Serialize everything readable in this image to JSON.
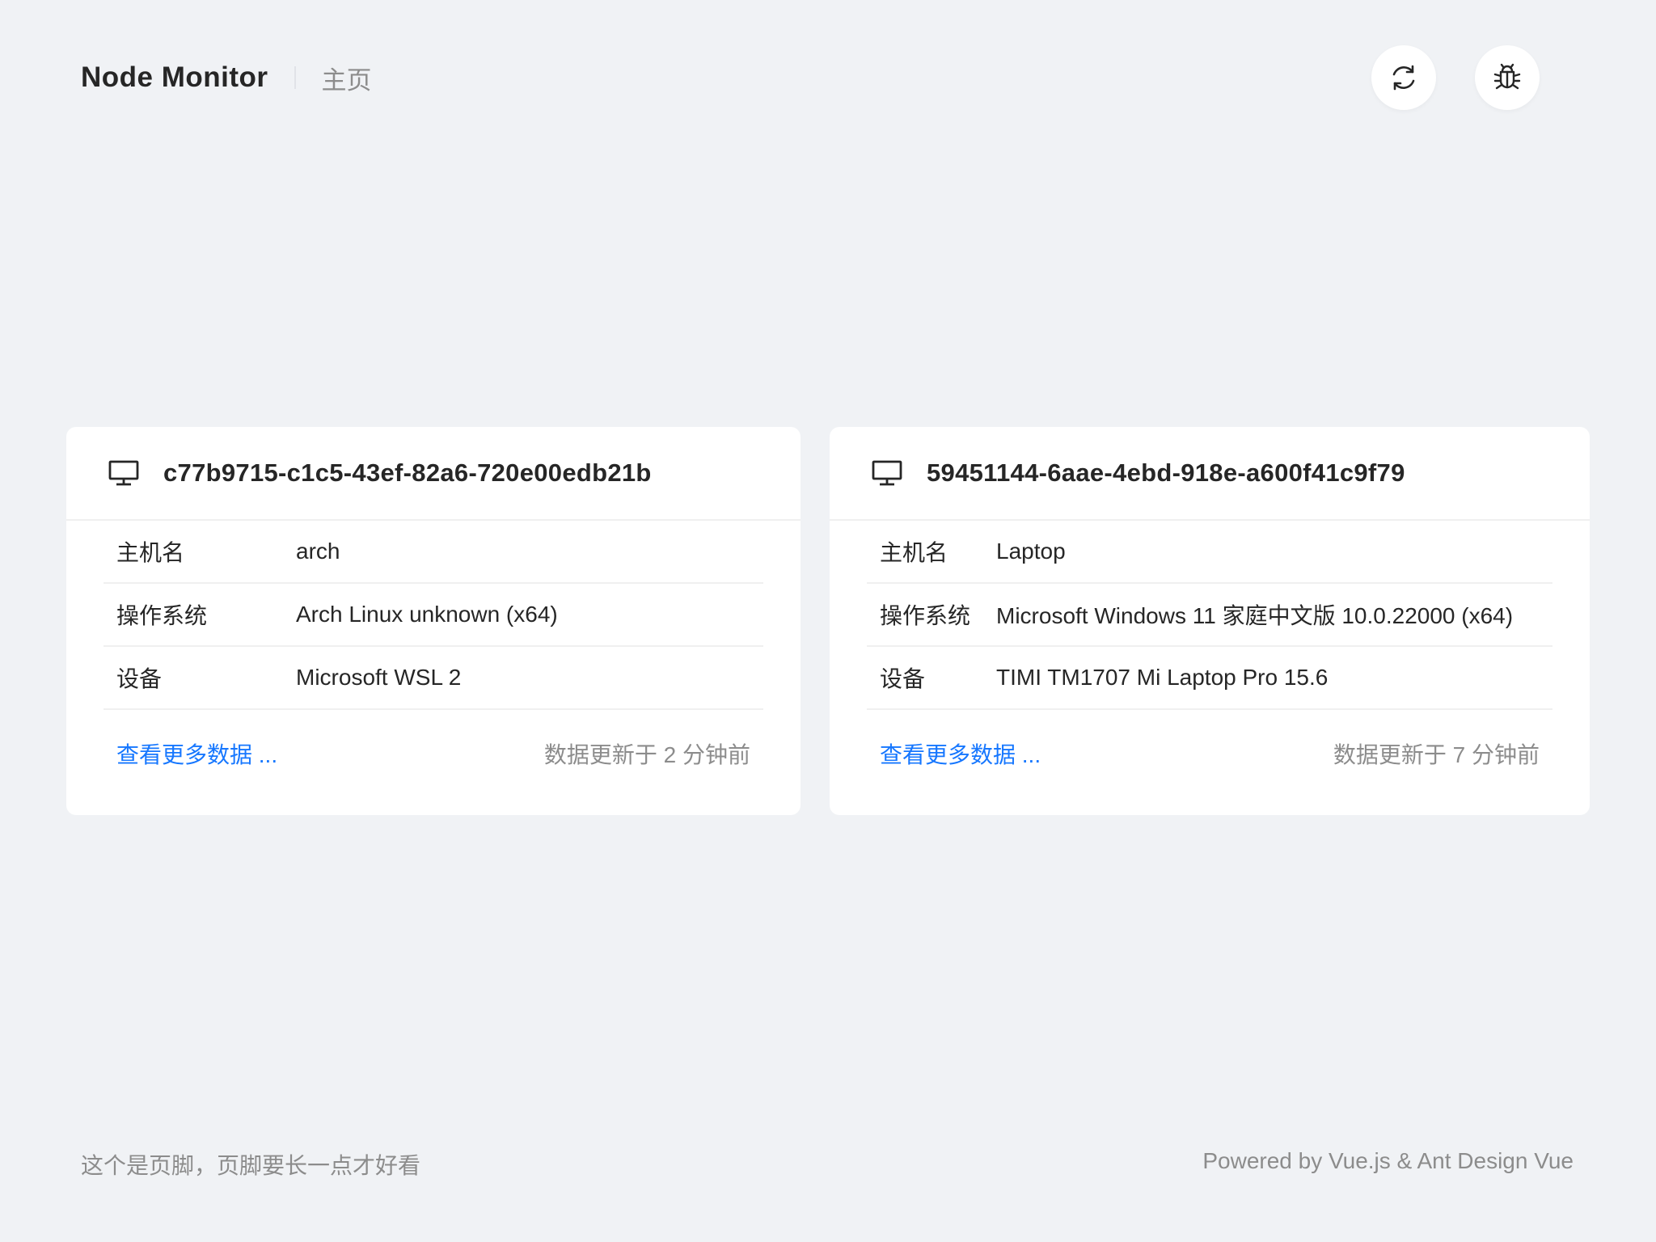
{
  "header": {
    "app_title": "Node Monitor",
    "breadcrumb": "主页",
    "icons": {
      "refresh": "refresh-icon",
      "debug": "bug-icon"
    }
  },
  "nodes": [
    {
      "id": "c77b9715-c1c5-43ef-82a6-720e00edb21b",
      "icon": "desktop-icon",
      "rows": [
        {
          "label": "主机名",
          "value": "arch"
        },
        {
          "label": "操作系统",
          "value": "Arch Linux unknown (x64)"
        },
        {
          "label": "设备",
          "value": "Microsoft WSL 2"
        }
      ],
      "more_link": "查看更多数据 ...",
      "updated": "数据更新于 2 分钟前"
    },
    {
      "id": "59451144-6aae-4ebd-918e-a600f41c9f79",
      "icon": "desktop-icon",
      "rows": [
        {
          "label": "主机名",
          "value": "Laptop"
        },
        {
          "label": "操作系统",
          "value": "Microsoft Windows 11 家庭中文版 10.0.22000 (x64)"
        },
        {
          "label": "设备",
          "value": "TIMI TM1707 Mi Laptop Pro 15.6"
        }
      ],
      "more_link": "查看更多数据 ...",
      "updated": "数据更新于 7 分钟前"
    }
  ],
  "footer": {
    "left": "这个是页脚，页脚要长一点才好看",
    "right": "Powered by Vue.js & Ant Design Vue"
  },
  "colors": {
    "background": "#f0f2f5",
    "card": "#ffffff",
    "link": "#1677ff",
    "muted": "#8c8c8c",
    "text": "#262626"
  }
}
